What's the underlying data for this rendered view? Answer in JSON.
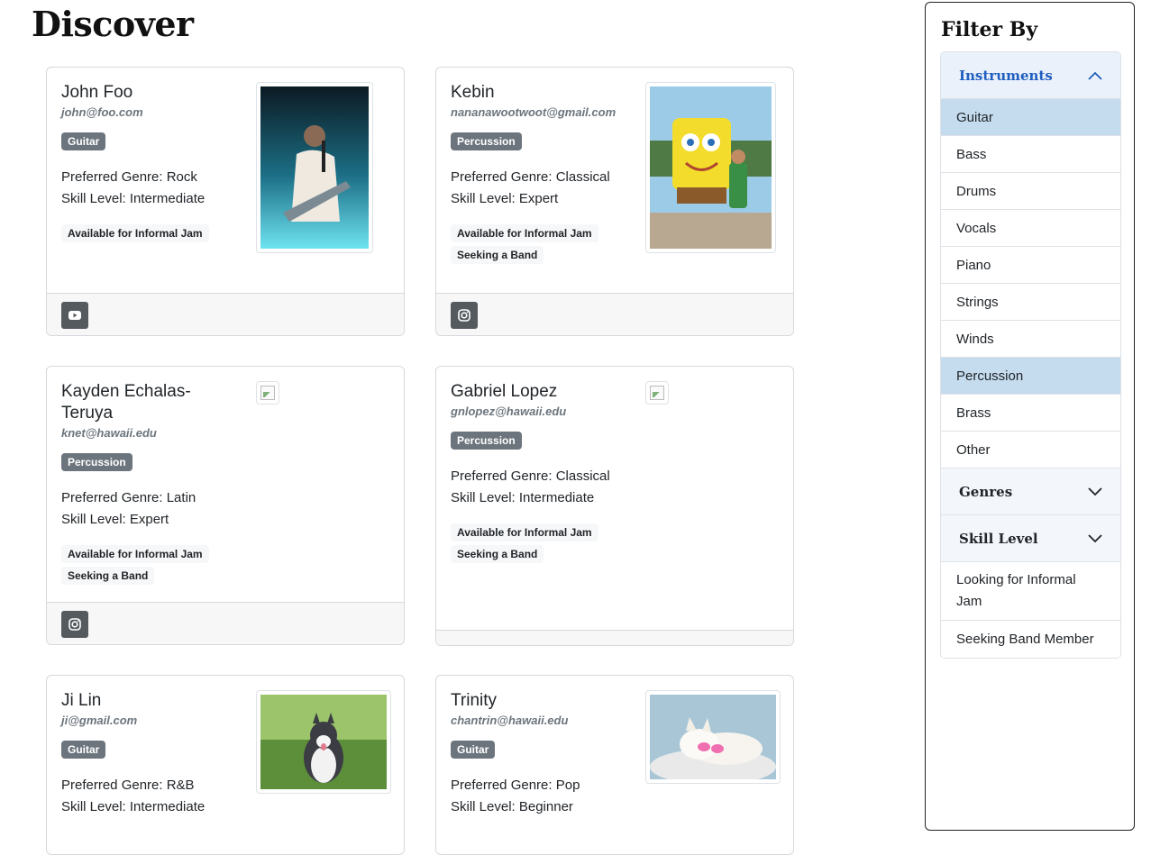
{
  "page": {
    "title": "Discover"
  },
  "cards": [
    {
      "name": "John Foo",
      "email": "john@foo.com",
      "instrument": "Guitar",
      "genre": "Preferred Genre: Rock",
      "skill": "Skill Level: Intermediate",
      "tags": [
        "Available for Informal Jam"
      ],
      "social": "youtube-icon",
      "photo": "guitarist-photo"
    },
    {
      "name": "Kebin",
      "email": "nananawootwoot@gmail.com",
      "instrument": "Percussion",
      "genre": "Preferred Genre: Classical",
      "skill": "Skill Level: Expert",
      "tags": [
        "Available for Informal Jam",
        "Seeking a Band"
      ],
      "social": "instagram-icon",
      "photo": "spongebob-mascot-photo"
    },
    {
      "name": "Kayden Echalas-Teruya",
      "email": "knet@hawaii.edu",
      "instrument": "Percussion",
      "genre": "Preferred Genre: Latin",
      "skill": "Skill Level: Expert",
      "tags": [
        "Available for Informal Jam",
        "Seeking a Band"
      ],
      "social": "instagram-icon",
      "photo": "broken-image-icon"
    },
    {
      "name": "Gabriel Lopez",
      "email": "gnlopez@hawaii.edu",
      "instrument": "Percussion",
      "genre": "Preferred Genre: Classical",
      "skill": "Skill Level: Intermediate",
      "tags": [
        "Available for Informal Jam",
        "Seeking a Band"
      ],
      "social": "",
      "photo": "broken-image-icon"
    },
    {
      "name": "Ji Lin",
      "email": "ji@gmail.com",
      "instrument": "Guitar",
      "genre": "Preferred Genre: R&B",
      "skill": "Skill Level: Intermediate",
      "tags": [],
      "social": "",
      "photo": "husky-puppy-photo"
    },
    {
      "name": "Trinity",
      "email": "chantrin@hawaii.edu",
      "instrument": "Guitar",
      "genre": "Preferred Genre: Pop",
      "skill": "Skill Level: Beginner",
      "tags": [],
      "social": "",
      "photo": "white-dog-sunglasses-photo"
    }
  ],
  "filter": {
    "title": "Filter By",
    "instruments_label": "Instruments",
    "instruments": [
      "Guitar",
      "Bass",
      "Drums",
      "Vocals",
      "Piano",
      "Strings",
      "Winds",
      "Percussion",
      "Brass",
      "Other"
    ],
    "selected_instruments": [
      "Guitar",
      "Percussion"
    ],
    "genres_label": "Genres",
    "skill_label": "Skill Level",
    "looking_jam": "Looking for Informal Jam",
    "seeking_band": "Seeking Band Member"
  },
  "colors": {
    "accent": "#1f5fbf",
    "selected_bg": "#c5dcef",
    "badge": "#6c757d"
  }
}
